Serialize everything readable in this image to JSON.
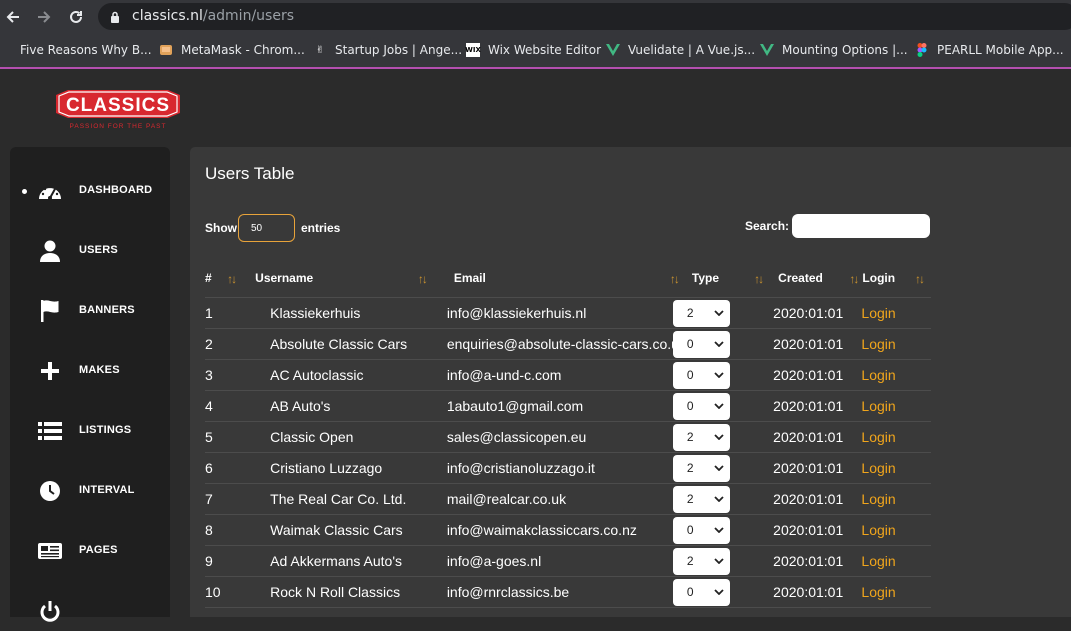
{
  "browser": {
    "url_host": "classics.nl",
    "url_path": "/admin/users",
    "bookmarks": [
      {
        "label": "Five Reasons Why B...",
        "icon": "generic-favicon"
      },
      {
        "label": "MetaMask - Chrom...",
        "icon": "metamask-icon"
      },
      {
        "label": "Startup Jobs | Ange...",
        "icon": "angellist-icon"
      },
      {
        "label": "Wix Website Editor",
        "icon": "wix-icon"
      },
      {
        "label": "Vuelidate | A Vue.js...",
        "icon": "vue-icon"
      },
      {
        "label": "Mounting Options |...",
        "icon": "vue-icon"
      },
      {
        "label": "PEARLL Mobile App...",
        "icon": "figma-icon"
      }
    ]
  },
  "logo": {
    "text": "CLASSICS",
    "tagline": "PASSION FOR THE PAST"
  },
  "sidebar": {
    "items": [
      {
        "label": "DASHBOARD",
        "icon": "speedometer-icon",
        "active": true
      },
      {
        "label": "USERS",
        "icon": "user-icon"
      },
      {
        "label": "BANNERS",
        "icon": "flag-icon"
      },
      {
        "label": "MAKES",
        "icon": "plus-icon"
      },
      {
        "label": "LISTINGS",
        "icon": "list-icon"
      },
      {
        "label": "INTERVAL",
        "icon": "clock-icon"
      },
      {
        "label": "PAGES",
        "icon": "pages-icon"
      }
    ]
  },
  "main": {
    "title": "Users Table",
    "show_label": "Show",
    "entries_value": "50",
    "entries_label": "entries",
    "search_label": "Search:",
    "search_value": "",
    "columns": [
      "#",
      "Username",
      "Email",
      "Type",
      "Created",
      "Login"
    ],
    "rows": [
      {
        "num": "1",
        "username": "Klassiekerhuis",
        "email": "info@klassiekerhuis.nl",
        "type": "2",
        "created": "2020:01:01",
        "login": "Login"
      },
      {
        "num": "2",
        "username": "Absolute Classic Cars",
        "email": "enquiries@absolute-classic-cars.co.uk",
        "type": "0",
        "created": "2020:01:01",
        "login": "Login"
      },
      {
        "num": "3",
        "username": "AC Autoclassic",
        "email": "info@a-und-c.com",
        "type": "0",
        "created": "2020:01:01",
        "login": "Login"
      },
      {
        "num": "4",
        "username": "AB Auto's",
        "email": "1abauto1@gmail.com",
        "type": "0",
        "created": "2020:01:01",
        "login": "Login"
      },
      {
        "num": "5",
        "username": "Classic Open",
        "email": "sales@classicopen.eu",
        "type": "2",
        "created": "2020:01:01",
        "login": "Login"
      },
      {
        "num": "6",
        "username": "Cristiano Luzzago",
        "email": "info@cristianoluzzago.it",
        "type": "2",
        "created": "2020:01:01",
        "login": "Login"
      },
      {
        "num": "7",
        "username": "The Real Car Co. Ltd.",
        "email": "mail@realcar.co.uk",
        "type": "2",
        "created": "2020:01:01",
        "login": "Login"
      },
      {
        "num": "8",
        "username": "Waimak Classic Cars",
        "email": "info@waimakclassiccars.co.nz",
        "type": "0",
        "created": "2020:01:01",
        "login": "Login"
      },
      {
        "num": "9",
        "username": "Ad Akkermans Auto's",
        "email": "info@a-goes.nl",
        "type": "2",
        "created": "2020:01:01",
        "login": "Login"
      },
      {
        "num": "10",
        "username": "Rock N Roll Classics",
        "email": "info@rnrclassics.be",
        "type": "0",
        "created": "2020:01:01",
        "login": "Login"
      }
    ]
  },
  "colors": {
    "accent": "#f0a51c",
    "sort_arrow": "#c9922f",
    "logo_red": "#d8282f"
  }
}
